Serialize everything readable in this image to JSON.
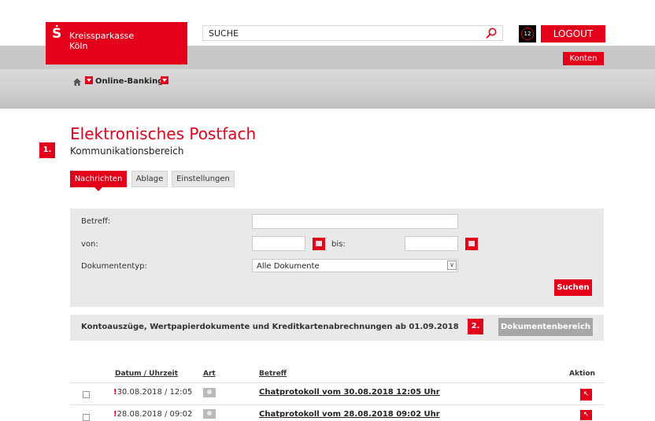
{
  "header": {
    "brand": {
      "line1": "Kreissparkasse",
      "line2": "Köln",
      "mark": "Ṡ"
    },
    "search": {
      "value": "SUCHE",
      "icon": "search-icon"
    },
    "timer": {
      "value": "12",
      "icon": "timer-icon"
    },
    "logout_label": "LOGOUT",
    "konten_label": "Konten"
  },
  "breadcrumb": {
    "home_icon": "home-icon",
    "label": "Online-Banking"
  },
  "page": {
    "title": "Elektronisches Postfach",
    "subtitle": "Kommunikationsbereich",
    "step1": "1.",
    "step2": "2."
  },
  "tabs": [
    {
      "label": "Nachrichten",
      "active": true
    },
    {
      "label": "Ablage",
      "active": false
    },
    {
      "label": "Einstellungen",
      "active": false
    }
  ],
  "filter": {
    "betreff_label": "Betreff:",
    "betreff_value": "",
    "von_label": "von:",
    "von_value": "",
    "bis_label": "bis:",
    "bis_value": "",
    "doctype_label": "Dokumententyp:",
    "doctype_value": "Alle Dokumente",
    "search_button": "Suchen"
  },
  "documents_band": {
    "text": "Kontoauszüge, Wertpapierdokumente und Kreditkartenabrechnungen ab 01.09.2018",
    "button": "Dokumentenbereich"
  },
  "table": {
    "headers": {
      "date": "Datum / Uhrzeit",
      "art": "Art",
      "subject": "Betreff",
      "action": "Aktion"
    },
    "rows": [
      {
        "mark": "!",
        "datetime": "30.08.2018 / 12:05",
        "subject": "Chatprotokoll vom 30.08.2018 12:05 Uhr",
        "action_icon": "open-arrow-icon"
      },
      {
        "mark": "!",
        "datetime": "28.08.2018 / 09:02",
        "subject": "Chatprotokoll vom 28.08.2018 09:02 Uhr",
        "action_icon": "open-arrow-icon"
      }
    ]
  },
  "colors": {
    "brand_red": "#e2001a",
    "panel_grey": "#e9e9e9",
    "band_grey": "#c8c8c8",
    "disabled_button": "#a6a6a6"
  }
}
